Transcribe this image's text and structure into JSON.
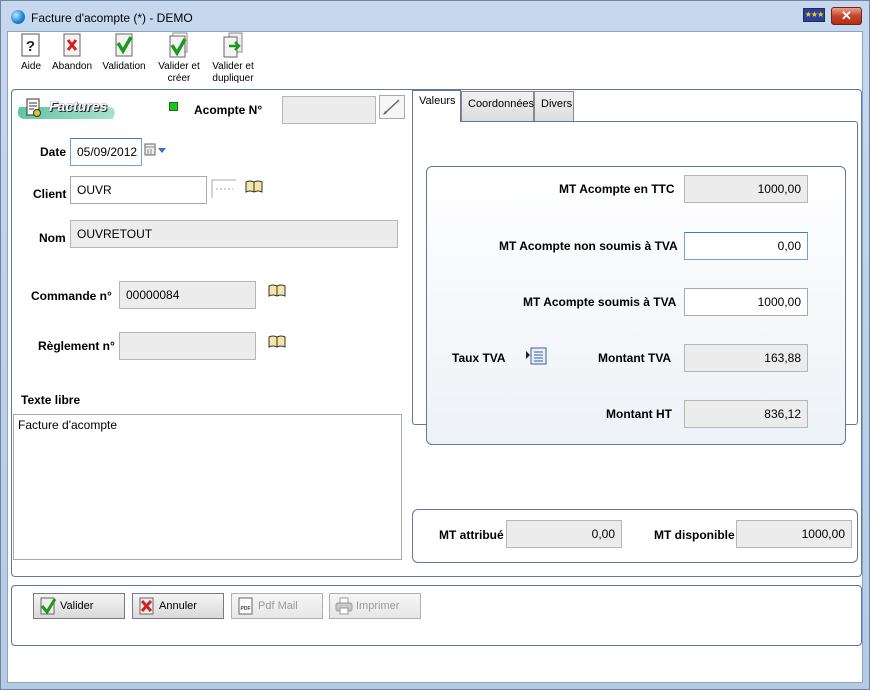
{
  "window": {
    "title": "Facture d'acompte (*)  - DEMO"
  },
  "toolbar": {
    "aide": "Aide",
    "abandon": "Abandon",
    "validation": "Validation",
    "valider_creer_1": "Valider et",
    "valider_creer_2": "créer",
    "valider_dupliquer_1": "Valider et",
    "valider_dupliquer_2": "dupliquer"
  },
  "header": {
    "badge": "Factures",
    "acompte_label": "Acompte N°",
    "acompte_value": ""
  },
  "form": {
    "date_label": "Date",
    "date_value": "05/09/2012",
    "client_label": "Client",
    "client_value": "OUVR",
    "nom_label": "Nom",
    "nom_value": "OUVRETOUT",
    "commande_label": "Commande n°",
    "commande_value": "00000084",
    "reglement_label": "Règlement n°",
    "reglement_value": "",
    "texte_label": "Texte libre",
    "texte_value": "Facture d'acompte"
  },
  "tabs": [
    {
      "label": "Valeurs"
    },
    {
      "label": "Coordonnées"
    },
    {
      "label": "Divers"
    }
  ],
  "valeurs": {
    "ttc_label": "MT Acompte en TTC",
    "ttc_value": "1000,00",
    "non_soumis_label": "MT Acompte non soumis à TVA",
    "non_soumis_value": "0,00",
    "soumis_label": "MT Acompte soumis à TVA",
    "soumis_value": "1000,00",
    "taux_label": "Taux TVA",
    "montant_tva_label": "Montant TVA",
    "montant_tva_value": "163,88",
    "montant_ht_label": "Montant HT",
    "montant_ht_value": "836,12"
  },
  "totals": {
    "attribue_label": "MT attribué",
    "attribue_value": "0,00",
    "disponible_label": "MT disponible",
    "disponible_value": "1000,00"
  },
  "buttons": {
    "valider": "Valider",
    "annuler": "Annuler",
    "pdf_mail": "Pdf Mail",
    "imprimer": "Imprimer"
  },
  "colors": {
    "accent_green": "#21c321",
    "panel_border": "#5a7aa0",
    "readonly_bg": "#ececec"
  }
}
